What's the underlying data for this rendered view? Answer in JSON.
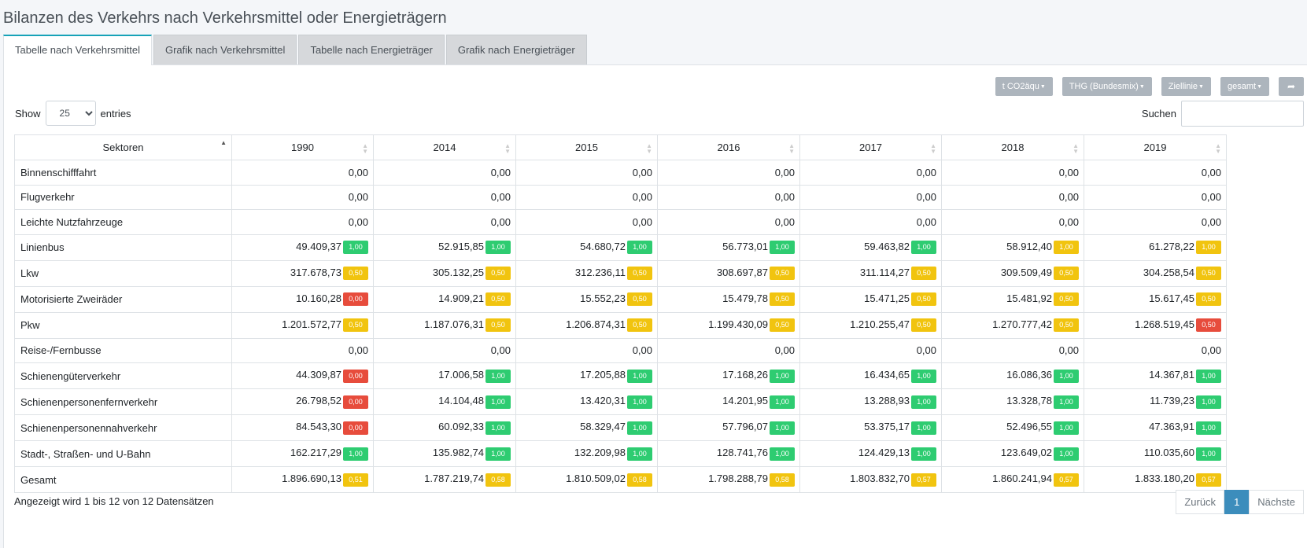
{
  "page_title": "Bilanzen des Verkehrs nach Verkehrsmittel oder Energieträgern",
  "tabs": [
    "Tabelle nach Verkehrsmittel",
    "Grafik nach Verkehrsmittel",
    "Tabelle nach Energieträger",
    "Grafik nach Energieträger"
  ],
  "active_tab": 0,
  "toolbar": {
    "unit": "t CO2äqu",
    "method": "THG (Bundesmix)",
    "target": "Ziellinie",
    "scope": "gesamt",
    "share_icon": "share-icon"
  },
  "length": {
    "show": "Show",
    "value": "25",
    "entries": "entries"
  },
  "search": {
    "label": "Suchen",
    "value": ""
  },
  "table": {
    "headers": [
      "Sektoren",
      "1990",
      "2014",
      "2015",
      "2016",
      "2017",
      "2018",
      "2019"
    ],
    "rows": [
      {
        "sector": "Binnenschifffahrt",
        "cells": [
          [
            "0,00",
            null,
            null
          ],
          [
            "0,00",
            null,
            null
          ],
          [
            "0,00",
            null,
            null
          ],
          [
            "0,00",
            null,
            null
          ],
          [
            "0,00",
            null,
            null
          ],
          [
            "0,00",
            null,
            null
          ],
          [
            "0,00",
            null,
            null
          ]
        ]
      },
      {
        "sector": "Flugverkehr",
        "cells": [
          [
            "0,00",
            null,
            null
          ],
          [
            "0,00",
            null,
            null
          ],
          [
            "0,00",
            null,
            null
          ],
          [
            "0,00",
            null,
            null
          ],
          [
            "0,00",
            null,
            null
          ],
          [
            "0,00",
            null,
            null
          ],
          [
            "0,00",
            null,
            null
          ]
        ]
      },
      {
        "sector": "Leichte Nutzfahrzeuge",
        "cells": [
          [
            "0,00",
            null,
            null
          ],
          [
            "0,00",
            null,
            null
          ],
          [
            "0,00",
            null,
            null
          ],
          [
            "0,00",
            null,
            null
          ],
          [
            "0,00",
            null,
            null
          ],
          [
            "0,00",
            null,
            null
          ],
          [
            "0,00",
            null,
            null
          ]
        ]
      },
      {
        "sector": "Linienbus",
        "cells": [
          [
            "49.409,37",
            "1,00",
            "green"
          ],
          [
            "52.915,85",
            "1,00",
            "green"
          ],
          [
            "54.680,72",
            "1,00",
            "green"
          ],
          [
            "56.773,01",
            "1,00",
            "green"
          ],
          [
            "59.463,82",
            "1,00",
            "green"
          ],
          [
            "58.912,40",
            "1,00",
            "yellow"
          ],
          [
            "61.278,22",
            "1,00",
            "yellow"
          ]
        ]
      },
      {
        "sector": "Lkw",
        "cells": [
          [
            "317.678,73",
            "0,50",
            "yellow"
          ],
          [
            "305.132,25",
            "0,50",
            "yellow"
          ],
          [
            "312.236,11",
            "0,50",
            "yellow"
          ],
          [
            "308.697,87",
            "0,50",
            "yellow"
          ],
          [
            "311.114,27",
            "0,50",
            "yellow"
          ],
          [
            "309.509,49",
            "0,50",
            "yellow"
          ],
          [
            "304.258,54",
            "0,50",
            "yellow"
          ]
        ]
      },
      {
        "sector": "Motorisierte Zweiräder",
        "cells": [
          [
            "10.160,28",
            "0,00",
            "red"
          ],
          [
            "14.909,21",
            "0,50",
            "yellow"
          ],
          [
            "15.552,23",
            "0,50",
            "yellow"
          ],
          [
            "15.479,78",
            "0,50",
            "yellow"
          ],
          [
            "15.471,25",
            "0,50",
            "yellow"
          ],
          [
            "15.481,92",
            "0,50",
            "yellow"
          ],
          [
            "15.617,45",
            "0,50",
            "yellow"
          ]
        ]
      },
      {
        "sector": "Pkw",
        "cells": [
          [
            "1.201.572,77",
            "0,50",
            "yellow"
          ],
          [
            "1.187.076,31",
            "0,50",
            "yellow"
          ],
          [
            "1.206.874,31",
            "0,50",
            "yellow"
          ],
          [
            "1.199.430,09",
            "0,50",
            "yellow"
          ],
          [
            "1.210.255,47",
            "0,50",
            "yellow"
          ],
          [
            "1.270.777,42",
            "0,50",
            "yellow"
          ],
          [
            "1.268.519,45",
            "0,50",
            "red"
          ]
        ]
      },
      {
        "sector": "Reise-/Fernbusse",
        "cells": [
          [
            "0,00",
            null,
            null
          ],
          [
            "0,00",
            null,
            null
          ],
          [
            "0,00",
            null,
            null
          ],
          [
            "0,00",
            null,
            null
          ],
          [
            "0,00",
            null,
            null
          ],
          [
            "0,00",
            null,
            null
          ],
          [
            "0,00",
            null,
            null
          ]
        ]
      },
      {
        "sector": "Schienengüterverkehr",
        "cells": [
          [
            "44.309,87",
            "0,00",
            "red"
          ],
          [
            "17.006,58",
            "1,00",
            "green"
          ],
          [
            "17.205,88",
            "1,00",
            "green"
          ],
          [
            "17.168,26",
            "1,00",
            "green"
          ],
          [
            "16.434,65",
            "1,00",
            "green"
          ],
          [
            "16.086,36",
            "1,00",
            "green"
          ],
          [
            "14.367,81",
            "1,00",
            "green"
          ]
        ]
      },
      {
        "sector": "Schienenpersonenfernverkehr",
        "cells": [
          [
            "26.798,52",
            "0,00",
            "red"
          ],
          [
            "14.104,48",
            "1,00",
            "green"
          ],
          [
            "13.420,31",
            "1,00",
            "green"
          ],
          [
            "14.201,95",
            "1,00",
            "green"
          ],
          [
            "13.288,93",
            "1,00",
            "green"
          ],
          [
            "13.328,78",
            "1,00",
            "green"
          ],
          [
            "11.739,23",
            "1,00",
            "green"
          ]
        ]
      },
      {
        "sector": "Schienenpersonennahverkehr",
        "cells": [
          [
            "84.543,30",
            "0,00",
            "red"
          ],
          [
            "60.092,33",
            "1,00",
            "green"
          ],
          [
            "58.329,47",
            "1,00",
            "green"
          ],
          [
            "57.796,07",
            "1,00",
            "green"
          ],
          [
            "53.375,17",
            "1,00",
            "green"
          ],
          [
            "52.496,55",
            "1,00",
            "green"
          ],
          [
            "47.363,91",
            "1,00",
            "green"
          ]
        ]
      },
      {
        "sector": "Stadt-, Straßen- und U-Bahn",
        "cells": [
          [
            "162.217,29",
            "1,00",
            "green"
          ],
          [
            "135.982,74",
            "1,00",
            "green"
          ],
          [
            "132.209,98",
            "1,00",
            "green"
          ],
          [
            "128.741,76",
            "1,00",
            "green"
          ],
          [
            "124.429,13",
            "1,00",
            "green"
          ],
          [
            "123.649,02",
            "1,00",
            "green"
          ],
          [
            "110.035,60",
            "1,00",
            "green"
          ]
        ]
      },
      {
        "sector": "Gesamt",
        "cells": [
          [
            "1.896.690,13",
            "0,51",
            "yellow"
          ],
          [
            "1.787.219,74",
            "0,58",
            "yellow"
          ],
          [
            "1.810.509,02",
            "0,58",
            "yellow"
          ],
          [
            "1.798.288,79",
            "0,58",
            "yellow"
          ],
          [
            "1.803.832,70",
            "0,57",
            "yellow"
          ],
          [
            "1.860.241,94",
            "0,57",
            "yellow"
          ],
          [
            "1.833.180,20",
            "0,57",
            "yellow"
          ]
        ]
      }
    ]
  },
  "info": "Angezeigt wird 1 bis 12 von 12 Datensätzen",
  "pager": {
    "prev": "Zurück",
    "current": "1",
    "next": "Nächste"
  },
  "colors": {
    "green": "#2ecc71",
    "yellow": "#f1c40f",
    "red": "#e74c3c",
    "accent": "#17a2b8",
    "pager_active": "#3c8dbc"
  }
}
